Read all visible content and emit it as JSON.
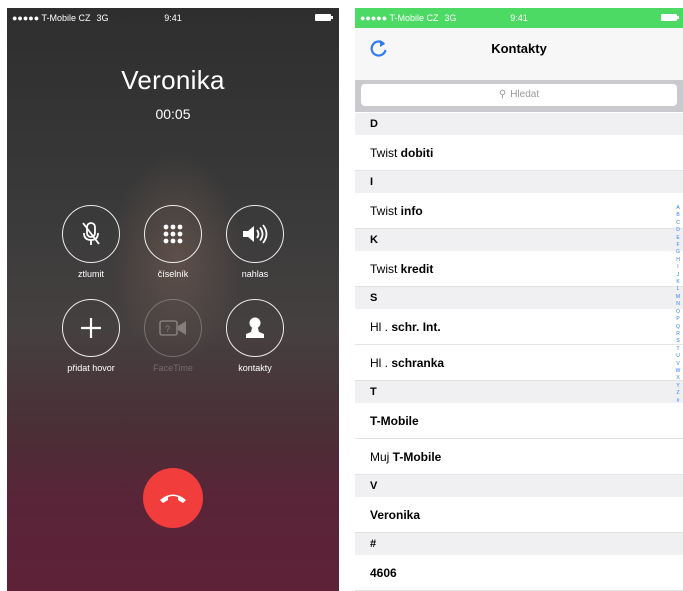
{
  "call": {
    "status": {
      "carrier": "●●●●● T-Mobile CZ",
      "network": "3G",
      "time": "9:41"
    },
    "caller_name": "Veronika",
    "timer": "00:05",
    "buttons": [
      {
        "label": "ztlumit",
        "icon": "mute-mic-icon",
        "enabled": true
      },
      {
        "label": "číselník",
        "icon": "keypad-icon",
        "enabled": true
      },
      {
        "label": "nahlas",
        "icon": "speaker-icon",
        "enabled": true
      },
      {
        "label": "přidat hovor",
        "icon": "plus-icon",
        "enabled": true
      },
      {
        "label": "FaceTime",
        "icon": "facetime-icon",
        "enabled": false
      },
      {
        "label": "kontakty",
        "icon": "contact-icon",
        "enabled": true
      }
    ],
    "end_call_color": "#f23d3d"
  },
  "contacts": {
    "status": {
      "carrier": "●●●●● T-Mobile CZ",
      "network": "3G",
      "time": "9:41"
    },
    "status_color": "#4cd964",
    "title": "Kontakty",
    "search_placeholder": "Hledat",
    "sections": [
      {
        "letter": "D",
        "items": [
          {
            "prefix": "Twist ",
            "bold": "dobiti"
          }
        ]
      },
      {
        "letter": "I",
        "items": [
          {
            "prefix": "Twist ",
            "bold": "info"
          }
        ]
      },
      {
        "letter": "K",
        "items": [
          {
            "prefix": "Twist ",
            "bold": "kredit"
          }
        ]
      },
      {
        "letter": "S",
        "items": [
          {
            "prefix": "Hl . ",
            "bold": "schr. Int."
          },
          {
            "prefix": "Hl . ",
            "bold": "schranka"
          }
        ]
      },
      {
        "letter": "T",
        "items": [
          {
            "prefix": "",
            "bold": "T-Mobile"
          },
          {
            "prefix": "Muj ",
            "bold": "T-Mobile"
          }
        ]
      },
      {
        "letter": "V",
        "items": [
          {
            "prefix": "",
            "bold": "Veronika"
          }
        ]
      },
      {
        "letter": "#",
        "items": [
          {
            "prefix": "",
            "bold": "4606"
          }
        ]
      }
    ],
    "index_letters": [
      "A",
      "B",
      "C",
      "D",
      "E",
      "F",
      "G",
      "H",
      "I",
      "J",
      "K",
      "L",
      "M",
      "N",
      "O",
      "P",
      "Q",
      "R",
      "S",
      "T",
      "U",
      "V",
      "W",
      "X",
      "Y",
      "Z",
      "#"
    ],
    "accent_color": "#2f7cf6"
  }
}
